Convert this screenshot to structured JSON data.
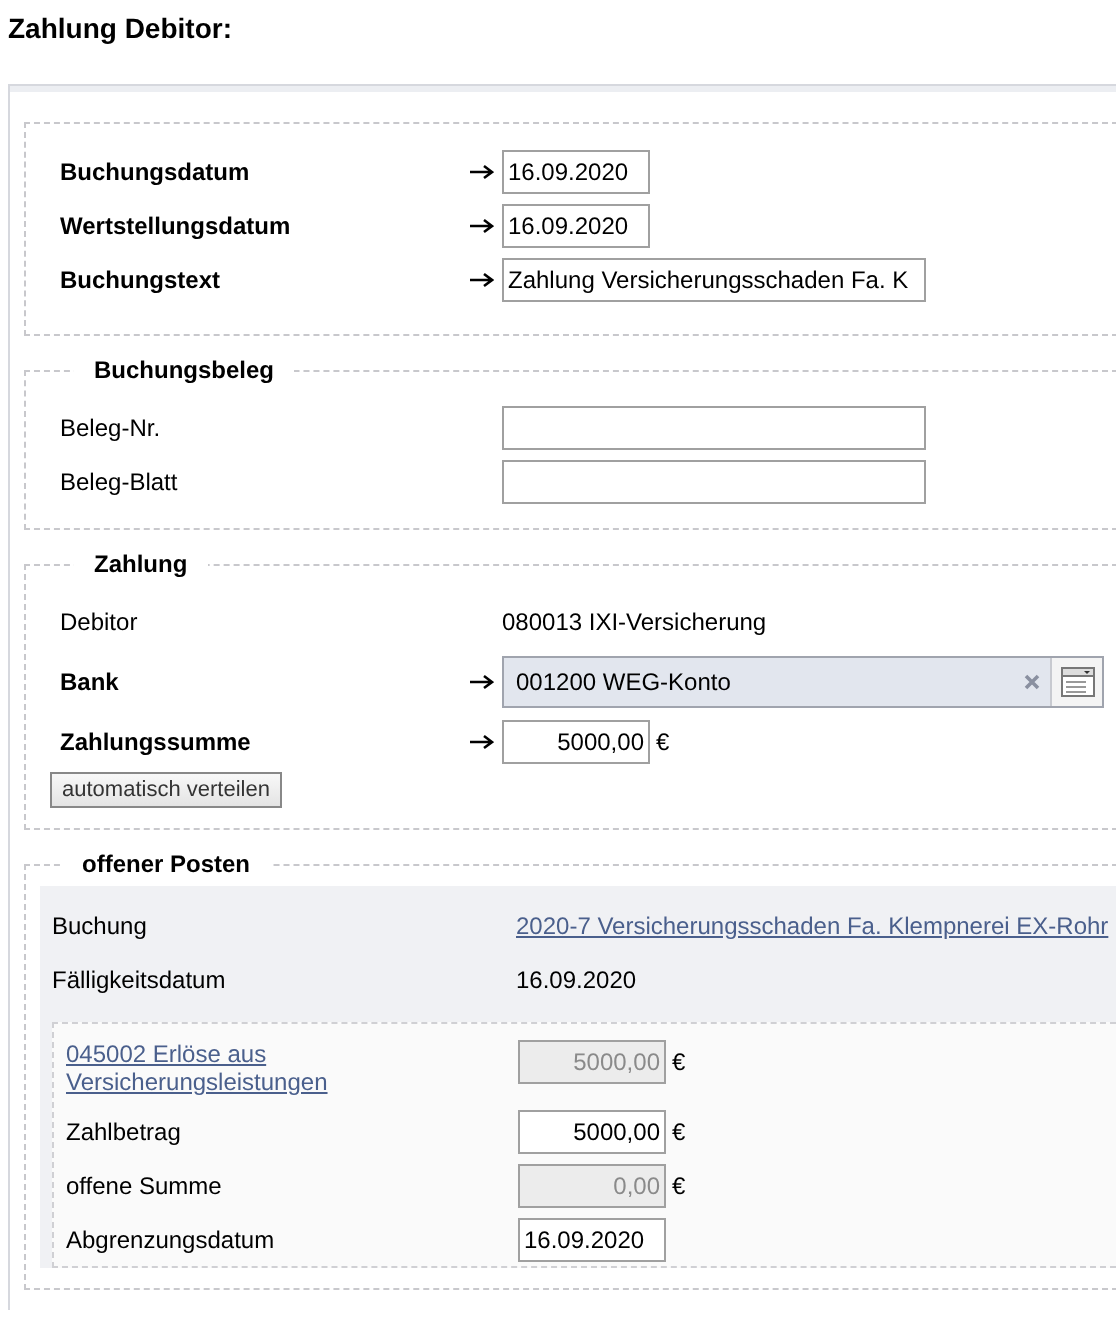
{
  "title": "Zahlung Debitor:",
  "booking": {
    "fields": [
      {
        "kind": "date",
        "label": "Buchungsdatum",
        "required": true,
        "value": "16.09.2020"
      },
      {
        "kind": "date",
        "label": "Wertstellungsdatum",
        "required": true,
        "value": "16.09.2020"
      },
      {
        "kind": "text",
        "label": "Buchungstext",
        "required": true,
        "value": "Zahlung Versicherungsschaden Fa. K"
      }
    ]
  },
  "voucher": {
    "legend": "Buchungsbeleg",
    "fields": [
      {
        "kind": "text",
        "label": "Beleg-Nr.",
        "required": false
      },
      {
        "kind": "text",
        "label": "Beleg-Blatt",
        "required": false
      }
    ]
  },
  "payment": {
    "legend": "Zahlung",
    "fields": [
      {
        "kind": "static",
        "label": "Debitor",
        "required": false,
        "value": "080013 IXI-Versicherung"
      },
      {
        "kind": "lookup",
        "label": "Bank",
        "required": true,
        "value": "001200 WEG-Konto"
      },
      {
        "kind": "amount",
        "label": "Zahlungssumme",
        "required": true,
        "value": "5000,00",
        "unit": "€"
      }
    ],
    "button": "automatisch verteilen"
  },
  "open_items": {
    "legend": "offener Posten",
    "booking": {
      "label": "Buchung",
      "link": "2020-7 Versicherungsschaden Fa. Klempnerei EX-Rohr"
    },
    "due": {
      "label": "Fälligkeitsdatum",
      "value": "16.09.2020"
    },
    "account": {
      "link": "045002 Erlöse aus Versicherungsleistungen",
      "value": "5000,00",
      "unit": "€",
      "disabled": true
    },
    "fields": [
      {
        "kind": "amount",
        "label": "Zahlbetrag",
        "value": "5000,00",
        "unit": "€",
        "disabled": false
      },
      {
        "kind": "amount",
        "label": "offene Summe",
        "value": "0,00",
        "unit": "€",
        "disabled": true
      },
      {
        "kind": "date",
        "label": "Abgrenzungsdatum",
        "value": "16.09.2020",
        "disabled": false
      }
    ]
  }
}
